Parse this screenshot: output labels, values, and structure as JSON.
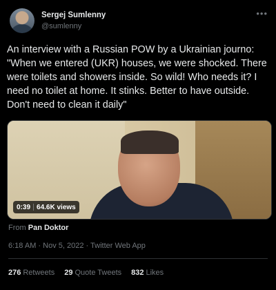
{
  "author": {
    "display_name": "Sergej Sumlenny",
    "handle": "@sumlenny"
  },
  "more_icon": "more-horizontal-icon",
  "tweet_text": "An interview with a Russian POW by a Ukrainian journo:\n\"When we entered (UKR) houses, we were shocked. There were toilets and showers inside. So wild! Who needs it? I need no toilet at home. It stinks. Better to have outside. Don't need to clean it daily\"",
  "video": {
    "duration": "0:39",
    "views": "64.6K views"
  },
  "from": {
    "prefix": "From",
    "source": "Pan Doktor"
  },
  "meta": {
    "timestamp": "6:18 AM · Nov 5, 2022 · Twitter Web App"
  },
  "stats": {
    "retweets_count": "276",
    "retweets_label": "Retweets",
    "quote_count": "29",
    "quote_label": "Quote Tweets",
    "likes_count": "832",
    "likes_label": "Likes"
  },
  "colors": {
    "background": "#000000",
    "text": "#e7e9ea",
    "secondary": "#71767b"
  }
}
